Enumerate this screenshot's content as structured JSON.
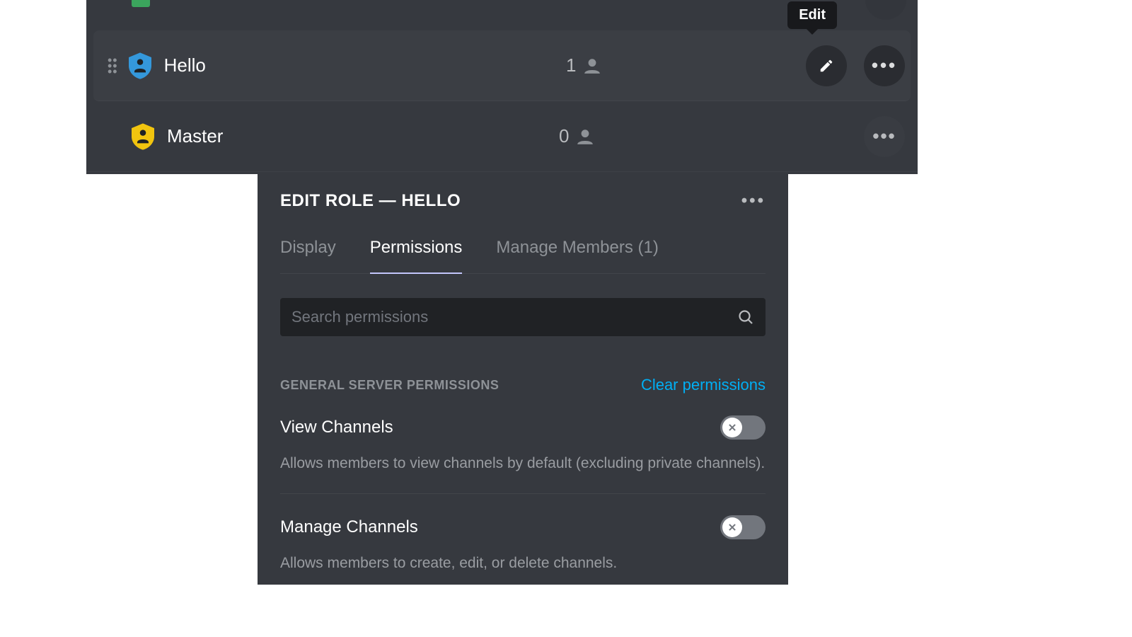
{
  "tooltip": {
    "edit": "Edit"
  },
  "roles": {
    "items": [
      {
        "name": "Hello",
        "count": "1",
        "shield_color": "#3498db"
      },
      {
        "name": "Master",
        "count": "0",
        "shield_color": "#f1c40f"
      }
    ]
  },
  "edit": {
    "title": "EDIT ROLE — HELLO",
    "tabs": {
      "display": "Display",
      "permissions": "Permissions",
      "members": "Manage Members (1)"
    },
    "search_placeholder": "Search permissions",
    "section_label": "GENERAL SERVER PERMISSIONS",
    "clear_link": "Clear permissions",
    "perms": [
      {
        "title": "View Channels",
        "desc": "Allows members to view channels by default (excluding private channels)."
      },
      {
        "title": "Manage Channels",
        "desc": "Allows members to create, edit, or delete channels."
      }
    ]
  }
}
